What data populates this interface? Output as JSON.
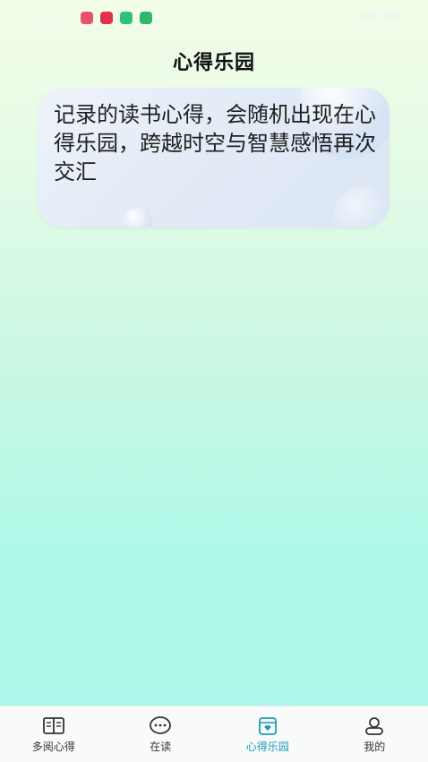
{
  "status_bar": {
    "time": "10:30",
    "apps": [
      {
        "name": "game-app-icon",
        "color": "#e8516a"
      },
      {
        "name": "video-app-icon",
        "color": "#e0304a"
      },
      {
        "name": "green-app-icon",
        "color": "#2cc27a"
      },
      {
        "name": "wechat-app-icon",
        "color": "#2fb86a"
      }
    ]
  },
  "header": {
    "title": "心得乐园"
  },
  "card": {
    "text": "记录的读书心得，会随机出现在心得乐园，跨越时空与智慧感悟再次交汇"
  },
  "tabbar": {
    "tabs": [
      {
        "label": "多阅心得",
        "icon": "book-icon",
        "active": false
      },
      {
        "label": "在读",
        "icon": "chat-bubble-icon",
        "active": false
      },
      {
        "label": "心得乐园",
        "icon": "wallet-heart-icon",
        "active": true
      },
      {
        "label": "我的",
        "icon": "user-icon",
        "active": false
      }
    ]
  },
  "colors": {
    "accent": "#1c9ab8",
    "text": "#1f1f1f"
  }
}
